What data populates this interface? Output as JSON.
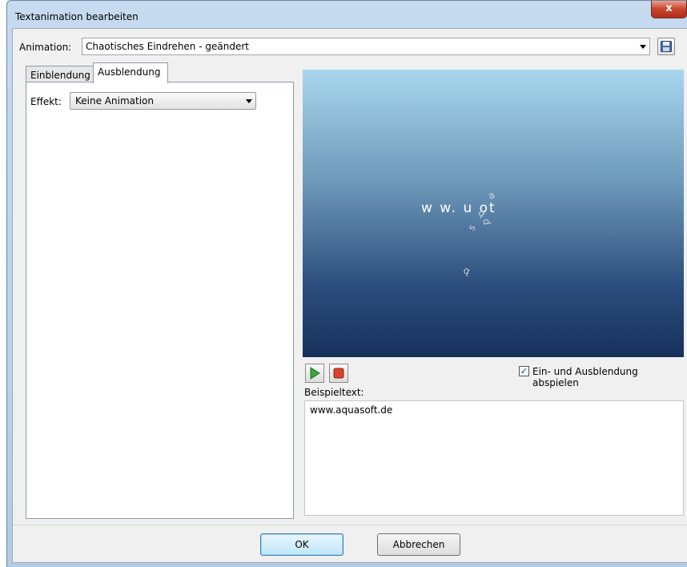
{
  "window": {
    "title": "Textanimation bearbeiten",
    "close_label": "x"
  },
  "animation": {
    "label": "Animation:",
    "value": "Chaotisches Eindrehen - geändert"
  },
  "tabs": [
    {
      "label": "Einblendung",
      "active": false
    },
    {
      "label": "Ausblendung",
      "active": true
    }
  ],
  "effekt": {
    "label": "Effekt:",
    "value": "Keine Animation"
  },
  "preview": {
    "text": "w w. u ot",
    "flying_letters": [
      "a",
      "q",
      "s",
      "d",
      "q"
    ]
  },
  "playback": {
    "play_icon": "play-icon",
    "stop_icon": "stop-icon"
  },
  "checkbox": {
    "label": "Ein- und Ausblendung abspielen",
    "checked": true
  },
  "beispiel": {
    "label": "Beispieltext:",
    "value": "www.aquasoft.de"
  },
  "buttons": {
    "ok": "OK",
    "cancel": "Abbrechen"
  },
  "colors": {
    "accent": "#3c7fb1",
    "preview_top": "#a9d6ee",
    "preview_bottom": "#16305c"
  }
}
